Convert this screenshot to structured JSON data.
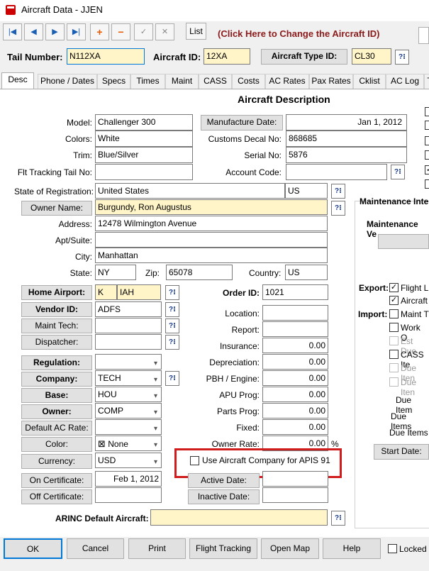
{
  "window": {
    "title": "Aircraft Data - JJEN"
  },
  "toolbar": {
    "list_label": "List",
    "change_id_link": "(Click Here to Change the Aircraft ID)"
  },
  "header": {
    "tail_number_label": "Tail Number:",
    "tail_number_value": "N112XA",
    "aircraft_id_label": "Aircraft ID:",
    "aircraft_id_value": "12XA",
    "aircraft_type_label": "Aircraft Type ID:",
    "aircraft_type_value": "CL30"
  },
  "tabs": [
    "Desc",
    "Phone / Dates",
    "Specs",
    "Times",
    "Maint",
    "CASS",
    "Costs",
    "AC Rates",
    "Pax Rates",
    "Cklist",
    "AC Log",
    "T"
  ],
  "section_title": "Aircraft Description",
  "desc": {
    "model_label": "Model:",
    "model_value": "Challenger 300",
    "colors_label": "Colors:",
    "colors_value": "White",
    "trim_label": "Trim:",
    "trim_value": "Blue/Silver",
    "flt_tracking_label": "Flt Tracking Tail No:",
    "flt_tracking_value": "",
    "manufacture_date_label": "Manufacture Date:",
    "manufacture_date_value": "Jan 1, 2012",
    "customs_decal_label": "Customs Decal No:",
    "customs_decal_value": "868685",
    "serial_no_label": "Serial No:",
    "serial_no_value": "5876",
    "account_code_label": "Account Code:",
    "account_code_value": "",
    "state_reg_label": "State of Registration:",
    "state_reg_value": "United States",
    "state_reg_code": "US",
    "owner_name_label": "Owner Name:",
    "owner_name_value": "Burgundy, Ron Augustus",
    "address_label": "Address:",
    "address_value": "12478 Wilmington Avenue",
    "apt_label": "Apt/Suite:",
    "apt_value": "",
    "city_label": "City:",
    "city_value": "Manhattan",
    "state_label": "State:",
    "state_value": "NY",
    "zip_label": "Zip:",
    "zip_value": "65078",
    "country_label": "Country:",
    "country_value": "US"
  },
  "airport": {
    "home_airport_label": "Home Airport:",
    "home_airport_code": "K",
    "home_airport_value": "IAH",
    "vendor_id_label": "Vendor ID:",
    "vendor_id_value": "ADFS",
    "maint_tech_label": "Maint Tech:",
    "maint_tech_value": "",
    "dispatcher_label": "Dispatcher:",
    "dispatcher_value": ""
  },
  "dropdowns": {
    "regulation_label": "Regulation:",
    "regulation_value": "",
    "company_label": "Company:",
    "company_value": "TECH",
    "base_label": "Base:",
    "base_value": "HOU",
    "owner_label": "Owner:",
    "owner_value": "COMP",
    "default_ac_rate_label": "Default AC Rate:",
    "default_ac_rate_value": "",
    "color_label": "Color:",
    "color_value": "None",
    "currency_label": "Currency:",
    "currency_value": "USD",
    "on_certificate_label": "On Certificate:",
    "on_certificate_value": "Feb 1, 2012",
    "off_certificate_label": "Off Certificate:",
    "off_certificate_value": ""
  },
  "order": {
    "order_id_label": "Order ID:",
    "order_id_value": "1021",
    "location_label": "Location:",
    "location_value": "",
    "report_label": "Report:",
    "report_value": "",
    "insurance_label": "Insurance:",
    "insurance_value": "0.00",
    "depreciation_label": "Depreciation:",
    "depreciation_value": "0.00",
    "pbh_label": "PBH / Engine:",
    "pbh_value": "0.00",
    "apu_label": "APU Prog:",
    "apu_value": "0.00",
    "parts_label": "Parts Prog:",
    "parts_value": "0.00",
    "fixed_label": "Fixed:",
    "fixed_value": "0.00",
    "owner_rate_label": "Owner Rate:",
    "owner_rate_value": "0.00",
    "owner_rate_unit": "%",
    "apis_label": "Use Aircraft Company for APIS 91",
    "active_date_label": "Active Date:",
    "active_date_value": "",
    "inactive_date_label": "Inactive Date:",
    "inactive_date_value": ""
  },
  "arinc": {
    "label": "ARINC Default Aircraft:",
    "value": ""
  },
  "sidepanel": {
    "maint_int_label": "Maintenance Inte",
    "maint_ve_label": "Maintenance Ve",
    "export_label": "Export:",
    "export_items": [
      "Flight L",
      "Aircraft"
    ],
    "import_label": "Import:",
    "import_items": [
      "Maint T",
      "Work O",
      "Est Due",
      "CASS Ite",
      "Due Iten",
      "Due Iten"
    ],
    "due_item_label": "Due Item",
    "due_items_label_1": "Due Items",
    "due_items_label_2": "Due Items",
    "start_date_label": "Start Date:"
  },
  "footer": {
    "ok": "OK",
    "cancel": "Cancel",
    "print": "Print",
    "flight_tracking": "Flight Tracking",
    "open_map": "Open Map",
    "help": "Help",
    "locked_label": "Locked"
  },
  "colors": {
    "required_yellow": "#fff5c8",
    "link_red": "#8b1a1a",
    "highlight_red": "#d01c1c",
    "accent_blue": "#0078d7"
  }
}
